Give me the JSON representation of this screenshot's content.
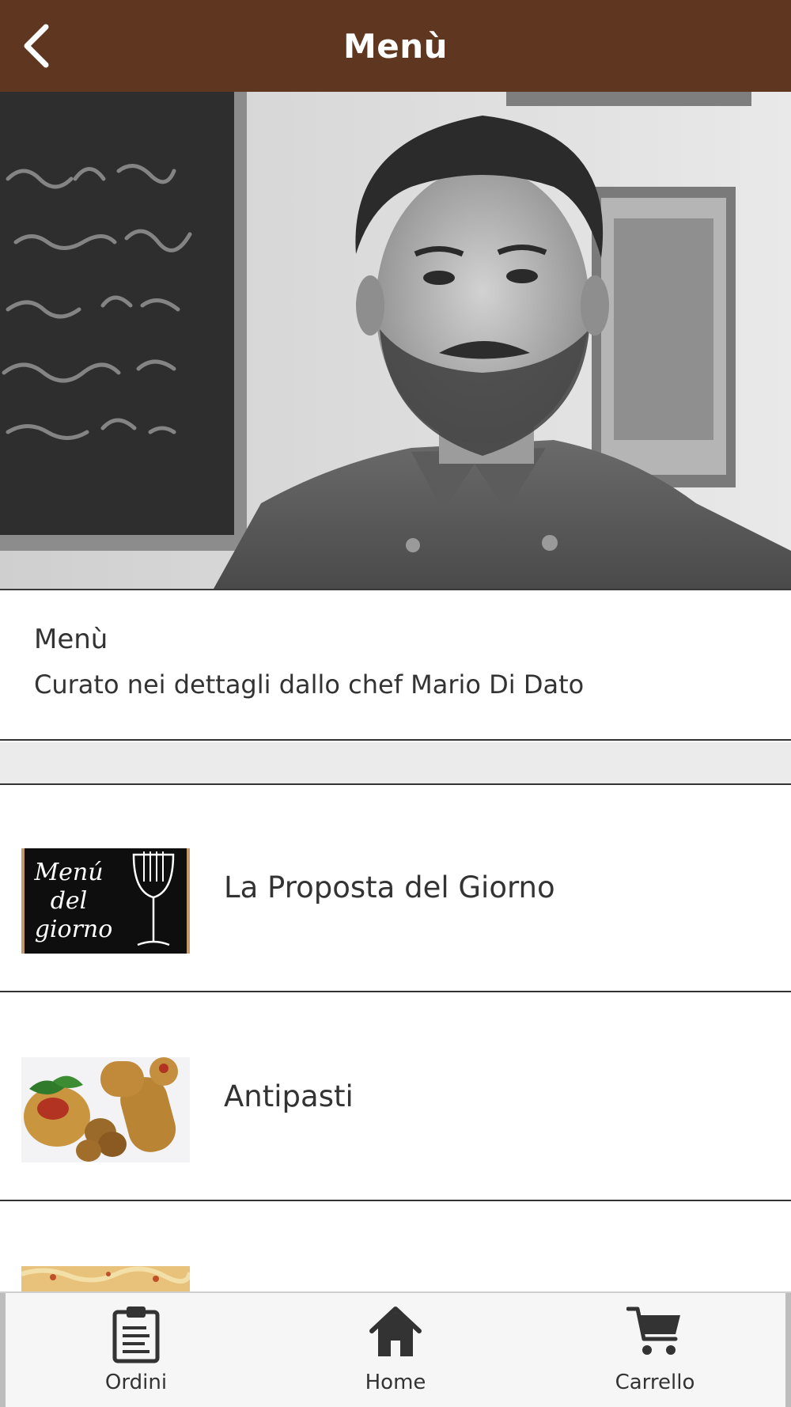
{
  "header": {
    "title": "Menù",
    "back_icon": "chevron-left-icon",
    "background_color": "#5f3720"
  },
  "hero": {
    "kind": "photo-chef-portrait"
  },
  "intro": {
    "title": "Menù",
    "subtitle": "Curato nei dettagli dallo chef Mario Di Dato"
  },
  "categories": [
    {
      "label": "La Proposta del Giorno",
      "thumb": {
        "line1": "Menú",
        "line2": "del",
        "line3": "giorno"
      }
    },
    {
      "label": "Antipasti"
    },
    {
      "label": ""
    }
  ],
  "tabbar": {
    "tabs": [
      {
        "label": "Ordini",
        "icon": "clipboard-icon"
      },
      {
        "label": "Home",
        "icon": "home-icon"
      },
      {
        "label": "Carrello",
        "icon": "cart-icon"
      }
    ]
  }
}
